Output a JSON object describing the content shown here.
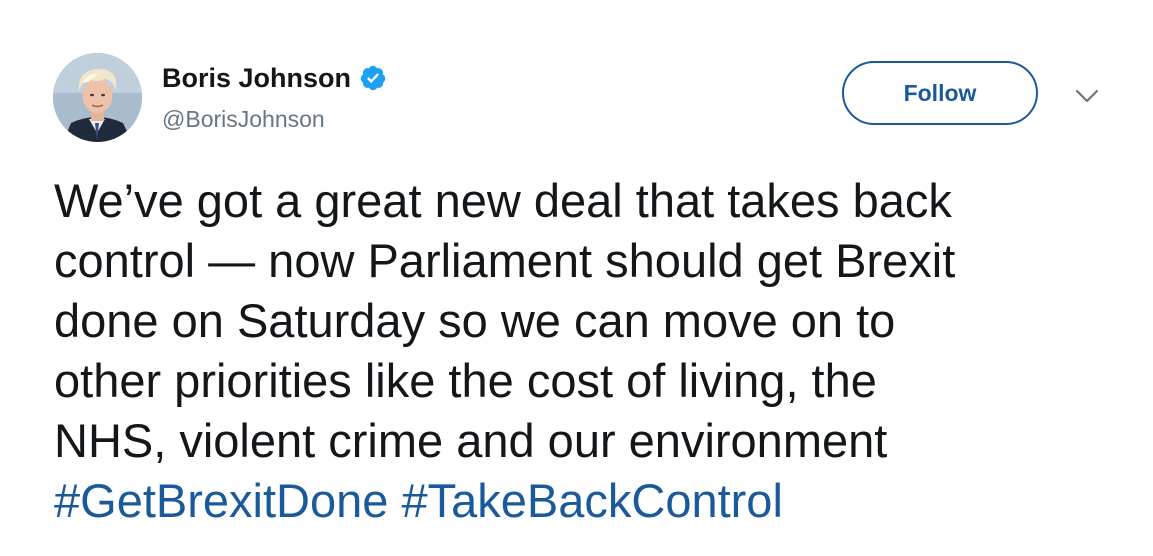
{
  "tweet": {
    "author": {
      "display_name": "Boris Johnson",
      "handle": "@BorisJohnson",
      "verified": true
    },
    "follow_label": "Follow",
    "text_lines": [
      "We’ve got a great new deal that takes back",
      "control — now Parliament should get Brexit",
      "done on Saturday so we can move on to",
      "other priorities like the cost of living, the",
      "NHS, violent crime and our environment"
    ],
    "hashtags": [
      "#GetBrexitDone",
      "#TakeBackControl"
    ]
  },
  "colors": {
    "text": "#14171a",
    "secondary": "#657786",
    "link": "#1b5a9a",
    "verified_badge": "#1da1f2"
  },
  "icons": {
    "verified": "verified-badge-icon",
    "caret": "chevron-down-icon"
  }
}
